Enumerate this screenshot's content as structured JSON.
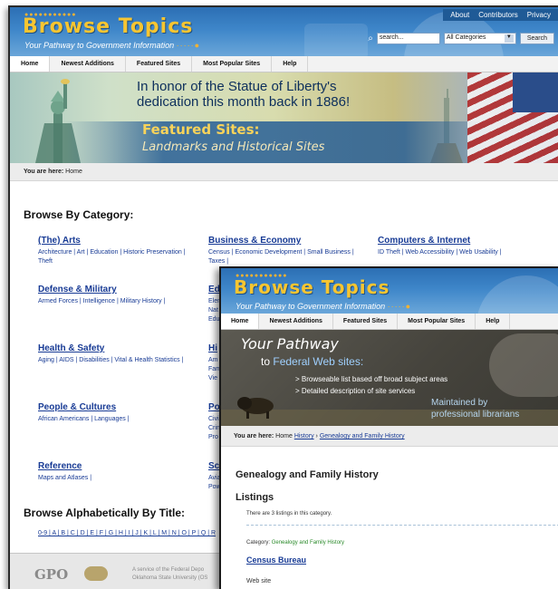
{
  "back": {
    "logo": "Browse Topics",
    "tagline": "Your Pathway to Government Information",
    "top_links": [
      "About",
      "Contributors",
      "Privacy"
    ],
    "search": {
      "placeholder": "search...",
      "category": "All Categories",
      "button": "Search"
    },
    "nav": [
      "Home",
      "Newest Additions",
      "Featured Sites",
      "Most Popular Sites",
      "Help"
    ],
    "banner": {
      "line1": "In honor of the Statue of Liberty's",
      "line2": "dedication this month back in 1886!",
      "featured": "Featured Sites:",
      "subtitle": "Landmarks and Historical Sites"
    },
    "breadcrumb": {
      "label": "You are here:",
      "current": "Home"
    },
    "browse_category_heading": "Browse By Category:",
    "categories": [
      {
        "title": "(The) Arts",
        "links": "Architecture | Art | Education | Historic Preservation | Theft"
      },
      {
        "title": "Business & Economy",
        "links": "Census | Economic Development | Small Business | Taxes |"
      },
      {
        "title": "Computers & Internet",
        "links": "ID Theft | Web Accessibility | Web Usability |"
      },
      {
        "title": "Defense & Military",
        "links": "Armed Forces | Intelligence | Military History |"
      },
      {
        "title": "Ed",
        "links": "Elem Nat Edu"
      },
      {
        "title": "Health & Safety",
        "links": "Aging | AIDS | Disabilities | Vital & Health Statistics |"
      },
      {
        "title": "Hi",
        "links": "Am Fam Vie"
      },
      {
        "title": "People & Cultures",
        "links": "African Americans | Languages |"
      },
      {
        "title": "Po",
        "links": "Civi Crin Pro"
      },
      {
        "title": "Reference",
        "links": "Maps and Atlases |"
      },
      {
        "title": "Sc",
        "links": "Avia Pow"
      }
    ],
    "browse_alpha_heading": "Browse Alphabetically By Title:",
    "alpha_links": "0-9 | A | B | C | D | E | F | G | H | I | J | K | L | M | N | O | P | Q | R",
    "footer": {
      "gpo": "GPO",
      "service": "A service of the Federal Depo",
      "service2": "Oklahoma State University (OS"
    }
  },
  "front": {
    "logo": "Browse Topics",
    "tagline": "Your Pathway to Government Information",
    "nav": [
      "Home",
      "Newest Additions",
      "Featured Sites",
      "Most Popular Sites",
      "Help"
    ],
    "banner": {
      "line1": "Your Pathway",
      "line2_pre": "to",
      "line2_hl": "Federal Web sites:",
      "bullet1": "> Browseable list based off broad subject areas",
      "bullet2": "> Detailed description of site services",
      "maintained1": "Maintained by",
      "maintained2": "professional librarians"
    },
    "breadcrumb": {
      "label": "You are here:",
      "home": "Home",
      "history": "History",
      "sep": "›",
      "current": "Genealogy and Family History"
    },
    "page_title": "Genealogy and Family History",
    "listings_heading": "Listings",
    "count_text": "There are 3 listings in this category.",
    "category_label": "Category:",
    "category_value": "Genealogy and Family History",
    "first_listing": "Census Bureau",
    "first_listing_type": "Web site"
  }
}
